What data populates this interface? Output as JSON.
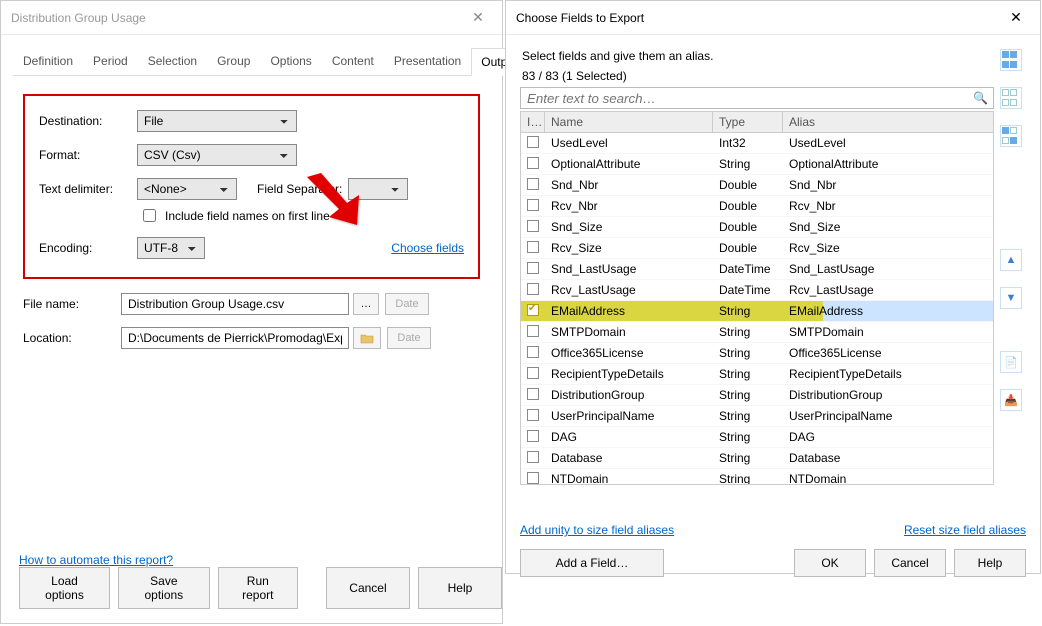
{
  "left": {
    "title": "Distribution Group Usage",
    "tabs": [
      "Definition",
      "Period",
      "Selection",
      "Group",
      "Options",
      "Content",
      "Presentation",
      "Output"
    ],
    "activeTab": "Output",
    "labels": {
      "destination": "Destination:",
      "format": "Format:",
      "textDelimiter": "Text delimiter:",
      "fieldSeparator": "Field Separator:",
      "includeFieldNames": "Include field names on first line",
      "encoding": "Encoding:",
      "chooseFields": "Choose fields",
      "fileName": "File name:",
      "location": "Location:",
      "date": "Date"
    },
    "values": {
      "destination": "File",
      "format": "CSV (Csv)",
      "textDelimiter": "<None>",
      "encoding": "UTF-8",
      "fileName": "Distribution Group Usage.csv",
      "location": "D:\\Documents de Pierrick\\Promodag\\Exp"
    },
    "automateLink": "How to automate this report?",
    "buttons": {
      "load": "Load options",
      "save": "Save options",
      "run": "Run report",
      "cancel": "Cancel",
      "help": "Help"
    }
  },
  "right": {
    "title": "Choose Fields to Export",
    "hint": "Select fields and give them an alias.",
    "count": "83 / 83 (1 Selected)",
    "searchPlaceholder": "Enter text to search…",
    "headers": {
      "ck": "I…",
      "name": "Name",
      "type": "Type",
      "alias": "Alias"
    },
    "rows": [
      {
        "name": "UsedLevel",
        "type": "Int32",
        "alias": "UsedLevel",
        "checked": false,
        "sel": false
      },
      {
        "name": "OptionalAttribute",
        "type": "String",
        "alias": "OptionalAttribute",
        "checked": false,
        "sel": false
      },
      {
        "name": "Snd_Nbr",
        "type": "Double",
        "alias": "Snd_Nbr",
        "checked": false,
        "sel": false
      },
      {
        "name": "Rcv_Nbr",
        "type": "Double",
        "alias": "Rcv_Nbr",
        "checked": false,
        "sel": false
      },
      {
        "name": "Snd_Size",
        "type": "Double",
        "alias": "Snd_Size",
        "checked": false,
        "sel": false
      },
      {
        "name": "Rcv_Size",
        "type": "Double",
        "alias": "Rcv_Size",
        "checked": false,
        "sel": false
      },
      {
        "name": "Snd_LastUsage",
        "type": "DateTime",
        "alias": "Snd_LastUsage",
        "checked": false,
        "sel": false
      },
      {
        "name": "Rcv_LastUsage",
        "type": "DateTime",
        "alias": "Rcv_LastUsage",
        "checked": false,
        "sel": false
      },
      {
        "name": "EMailAddress",
        "type": "String",
        "alias": "EMailAddress",
        "checked": true,
        "sel": true
      },
      {
        "name": "SMTPDomain",
        "type": "String",
        "alias": "SMTPDomain",
        "checked": false,
        "sel": false
      },
      {
        "name": "Office365License",
        "type": "String",
        "alias": "Office365License",
        "checked": false,
        "sel": false
      },
      {
        "name": "RecipientTypeDetails",
        "type": "String",
        "alias": "RecipientTypeDetails",
        "checked": false,
        "sel": false
      },
      {
        "name": "DistributionGroup",
        "type": "String",
        "alias": "DistributionGroup",
        "checked": false,
        "sel": false
      },
      {
        "name": "UserPrincipalName",
        "type": "String",
        "alias": "UserPrincipalName",
        "checked": false,
        "sel": false
      },
      {
        "name": "DAG",
        "type": "String",
        "alias": "DAG",
        "checked": false,
        "sel": false
      },
      {
        "name": "Database",
        "type": "String",
        "alias": "Database",
        "checked": false,
        "sel": false
      },
      {
        "name": "NTDomain",
        "type": "String",
        "alias": "NTDomain",
        "checked": false,
        "sel": false
      }
    ],
    "links": {
      "addUnity": "Add unity to size field aliases",
      "reset": "Reset size field aliases"
    },
    "buttons": {
      "addField": "Add a Field…",
      "ok": "OK",
      "cancel": "Cancel",
      "help": "Help"
    }
  }
}
